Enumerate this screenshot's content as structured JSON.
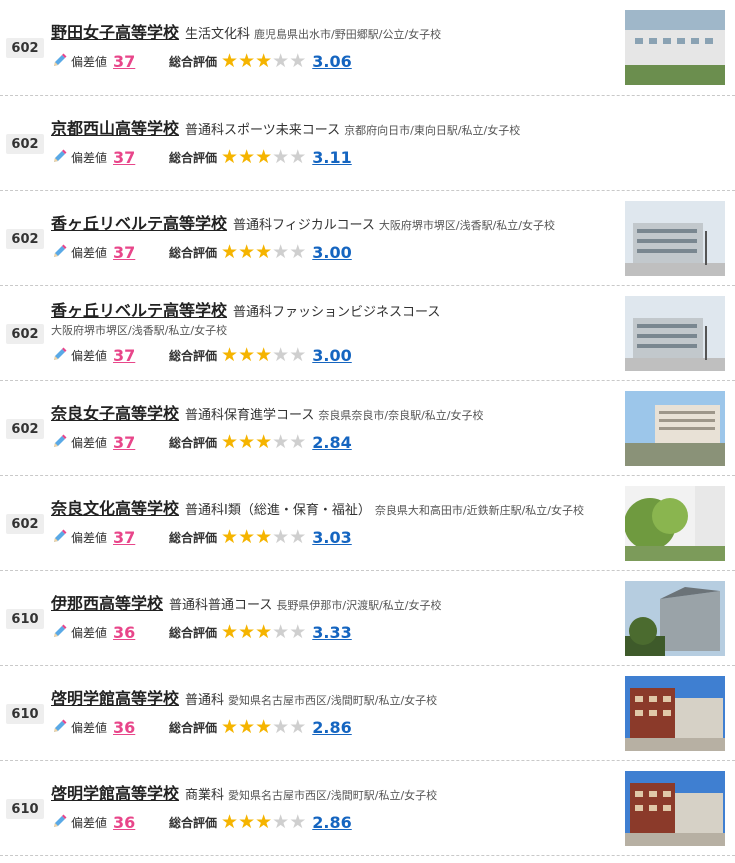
{
  "labels": {
    "deviation": "偏差値",
    "rating": "総合評価"
  },
  "schools": [
    {
      "rank": "602",
      "name": "野田女子高等学校",
      "course": "生活文化科",
      "location": "鹿児島県出水市/野田郷駅/公立/女子校",
      "deviation": "37",
      "score": "3.06",
      "stars": 3,
      "has_photo": true,
      "loc_wrap": false
    },
    {
      "rank": "602",
      "name": "京都西山高等学校",
      "course": "普通科スポーツ未来コース",
      "location": "京都府向日市/東向日駅/私立/女子校",
      "deviation": "37",
      "score": "3.11",
      "stars": 3,
      "has_photo": false,
      "loc_wrap": false
    },
    {
      "rank": "602",
      "name": "香ヶ丘リベルテ高等学校",
      "course": "普通科フィジカルコース",
      "location": "大阪府堺市堺区/浅香駅/私立/女子校",
      "deviation": "37",
      "score": "3.00",
      "stars": 3,
      "has_photo": true,
      "loc_wrap": false
    },
    {
      "rank": "602",
      "name": "香ヶ丘リベルテ高等学校",
      "course": "普通科ファッションビジネスコース",
      "location": "大阪府堺市堺区/浅香駅/私立/女子校",
      "deviation": "37",
      "score": "3.00",
      "stars": 3,
      "has_photo": true,
      "loc_wrap": true
    },
    {
      "rank": "602",
      "name": "奈良女子高等学校",
      "course": "普通科保育進学コース",
      "location": "奈良県奈良市/奈良駅/私立/女子校",
      "deviation": "37",
      "score": "2.84",
      "stars": 3,
      "has_photo": true,
      "loc_wrap": false
    },
    {
      "rank": "602",
      "name": "奈良文化高等学校",
      "course": "普通科Ⅰ類（総進・保育・福祉）",
      "location": "奈良県大和高田市/近鉄新庄駅/私立/女子校",
      "deviation": "37",
      "score": "3.03",
      "stars": 3,
      "has_photo": true,
      "loc_wrap": false
    },
    {
      "rank": "610",
      "name": "伊那西高等学校",
      "course": "普通科普通コース",
      "location": "長野県伊那市/沢渡駅/私立/女子校",
      "deviation": "36",
      "score": "3.33",
      "stars": 3,
      "has_photo": true,
      "loc_wrap": false
    },
    {
      "rank": "610",
      "name": "啓明学館高等学校",
      "course": "普通科",
      "location": "愛知県名古屋市西区/浅間町駅/私立/女子校",
      "deviation": "36",
      "score": "2.86",
      "stars": 3,
      "has_photo": true,
      "loc_wrap": false
    },
    {
      "rank": "610",
      "name": "啓明学館高等学校",
      "course": "商業科",
      "location": "愛知県名古屋市西区/浅間町駅/私立/女子校",
      "deviation": "36",
      "score": "2.86",
      "stars": 3,
      "has_photo": true,
      "loc_wrap": false
    }
  ],
  "icons": {
    "pencil": "pencil-icon",
    "star": "star-icon",
    "photo": "school-photo"
  },
  "colors": {
    "deviation": "#e8468a",
    "score": "#1565c0",
    "star_on": "#f5b400",
    "star_off": "#cfcfcf"
  }
}
